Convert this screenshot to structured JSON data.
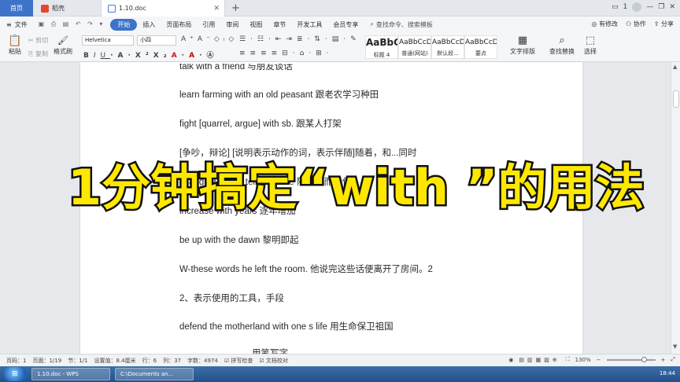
{
  "tabs": {
    "home": "首页",
    "shell": "稻壳",
    "doc": "1.10.doc"
  },
  "title_right": {
    "num": "1"
  },
  "menu": {
    "file": "文件",
    "items": [
      "开始",
      "插入",
      "页面布局",
      "引用",
      "审阅",
      "视图",
      "章节",
      "开发工具",
      "会员专享"
    ],
    "search_placeholder": "查找命令、搜索模板",
    "changes": "有修改",
    "collab": "协作",
    "share": "分享"
  },
  "ribbon": {
    "paste": "粘贴",
    "cut": "剪切",
    "copy": "复制",
    "format_painter": "格式刷",
    "font_name": "Helvetica",
    "font_size": "小四",
    "styles": [
      {
        "sample": "AaBbC",
        "name": "标题 4"
      },
      {
        "sample": "AaBbCcD",
        "name": "普通(网站)"
      },
      {
        "sample": "AaBbCcDd",
        "name": "默认段..."
      },
      {
        "sample": "AaBbCcDc",
        "name": "要点"
      }
    ],
    "text_layout": "文字排版",
    "find_replace": "查找替换",
    "select": "选择"
  },
  "document": {
    "lines": [
      "talk with a friend  与朋友谈话",
      "learn farming with an old peasant  跟老农学习种田",
      "fight [quarrel, argue] with sb.  跟某人打架",
      "[争吵，辩论] [说明表示动作的词，表示伴随]随着，和...同时",
      "change with the temperature  随温度而变化",
      "increase with years  逐年增加",
      "be up with the dawn  黎明即起",
      "W-these words he left the room.  他说完这些话便离开了房间。2",
      "2、表示使用的工具，手段",
      "defend the motherland with one s life  用生命保卫祖国",
      "用笔写字"
    ]
  },
  "overlay_title": "1分钟搞定“with ”的用法",
  "status": {
    "page_num": "页码：1",
    "page": "页面：1/19",
    "section": "节：1/1",
    "setting": "设置值：8.4厘米",
    "row": "行：6",
    "col": "列：37",
    "words": "字数：4974",
    "spell": "拼写检查",
    "proof": "文档校对",
    "zoom": "130%"
  },
  "taskbar": {
    "task1": "1.10.doc - WPS",
    "task2": "C:\\Documents an...",
    "clock": "18:44"
  }
}
